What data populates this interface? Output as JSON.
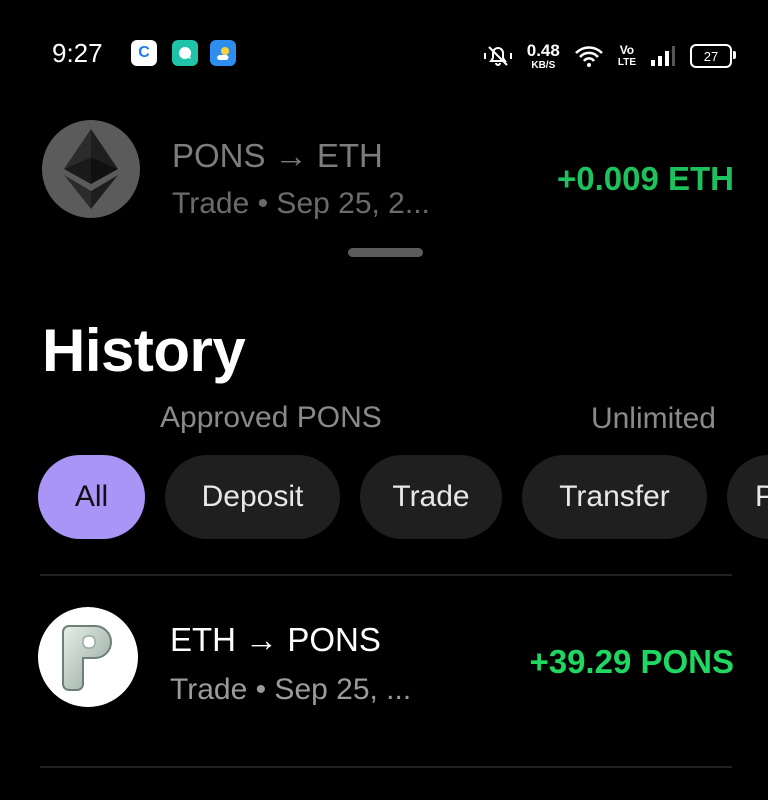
{
  "status_bar": {
    "time": "9:27",
    "net_speed_value": "0.48",
    "net_speed_unit": "KB/S",
    "volte_top": "Vo",
    "volte_bottom": "LTE",
    "battery": "27"
  },
  "peek_transaction": {
    "title": "PONS → ETH",
    "subtitle": "Trade • Sep 25, 2...",
    "amount": "+0.009 ETH",
    "icon": "ethereum-icon"
  },
  "header": {
    "title": "History"
  },
  "approval": {
    "label": "Approved PONS",
    "value": "Unlimited"
  },
  "filters": [
    {
      "label": "All",
      "active": true
    },
    {
      "label": "Deposit",
      "active": false
    },
    {
      "label": "Trade",
      "active": false
    },
    {
      "label": "Transfer",
      "active": false
    },
    {
      "label": "P",
      "active": false
    }
  ],
  "transactions": [
    {
      "title": "ETH → PONS",
      "subtitle": "Trade •  Sep 25, ...",
      "amount": "+39.29 PONS",
      "icon": "pons-token-icon"
    }
  ],
  "colors": {
    "background": "#000000",
    "positive_amount": "#1ed861",
    "active_chip": "#a895f6",
    "chip": "#1f1f1f"
  }
}
